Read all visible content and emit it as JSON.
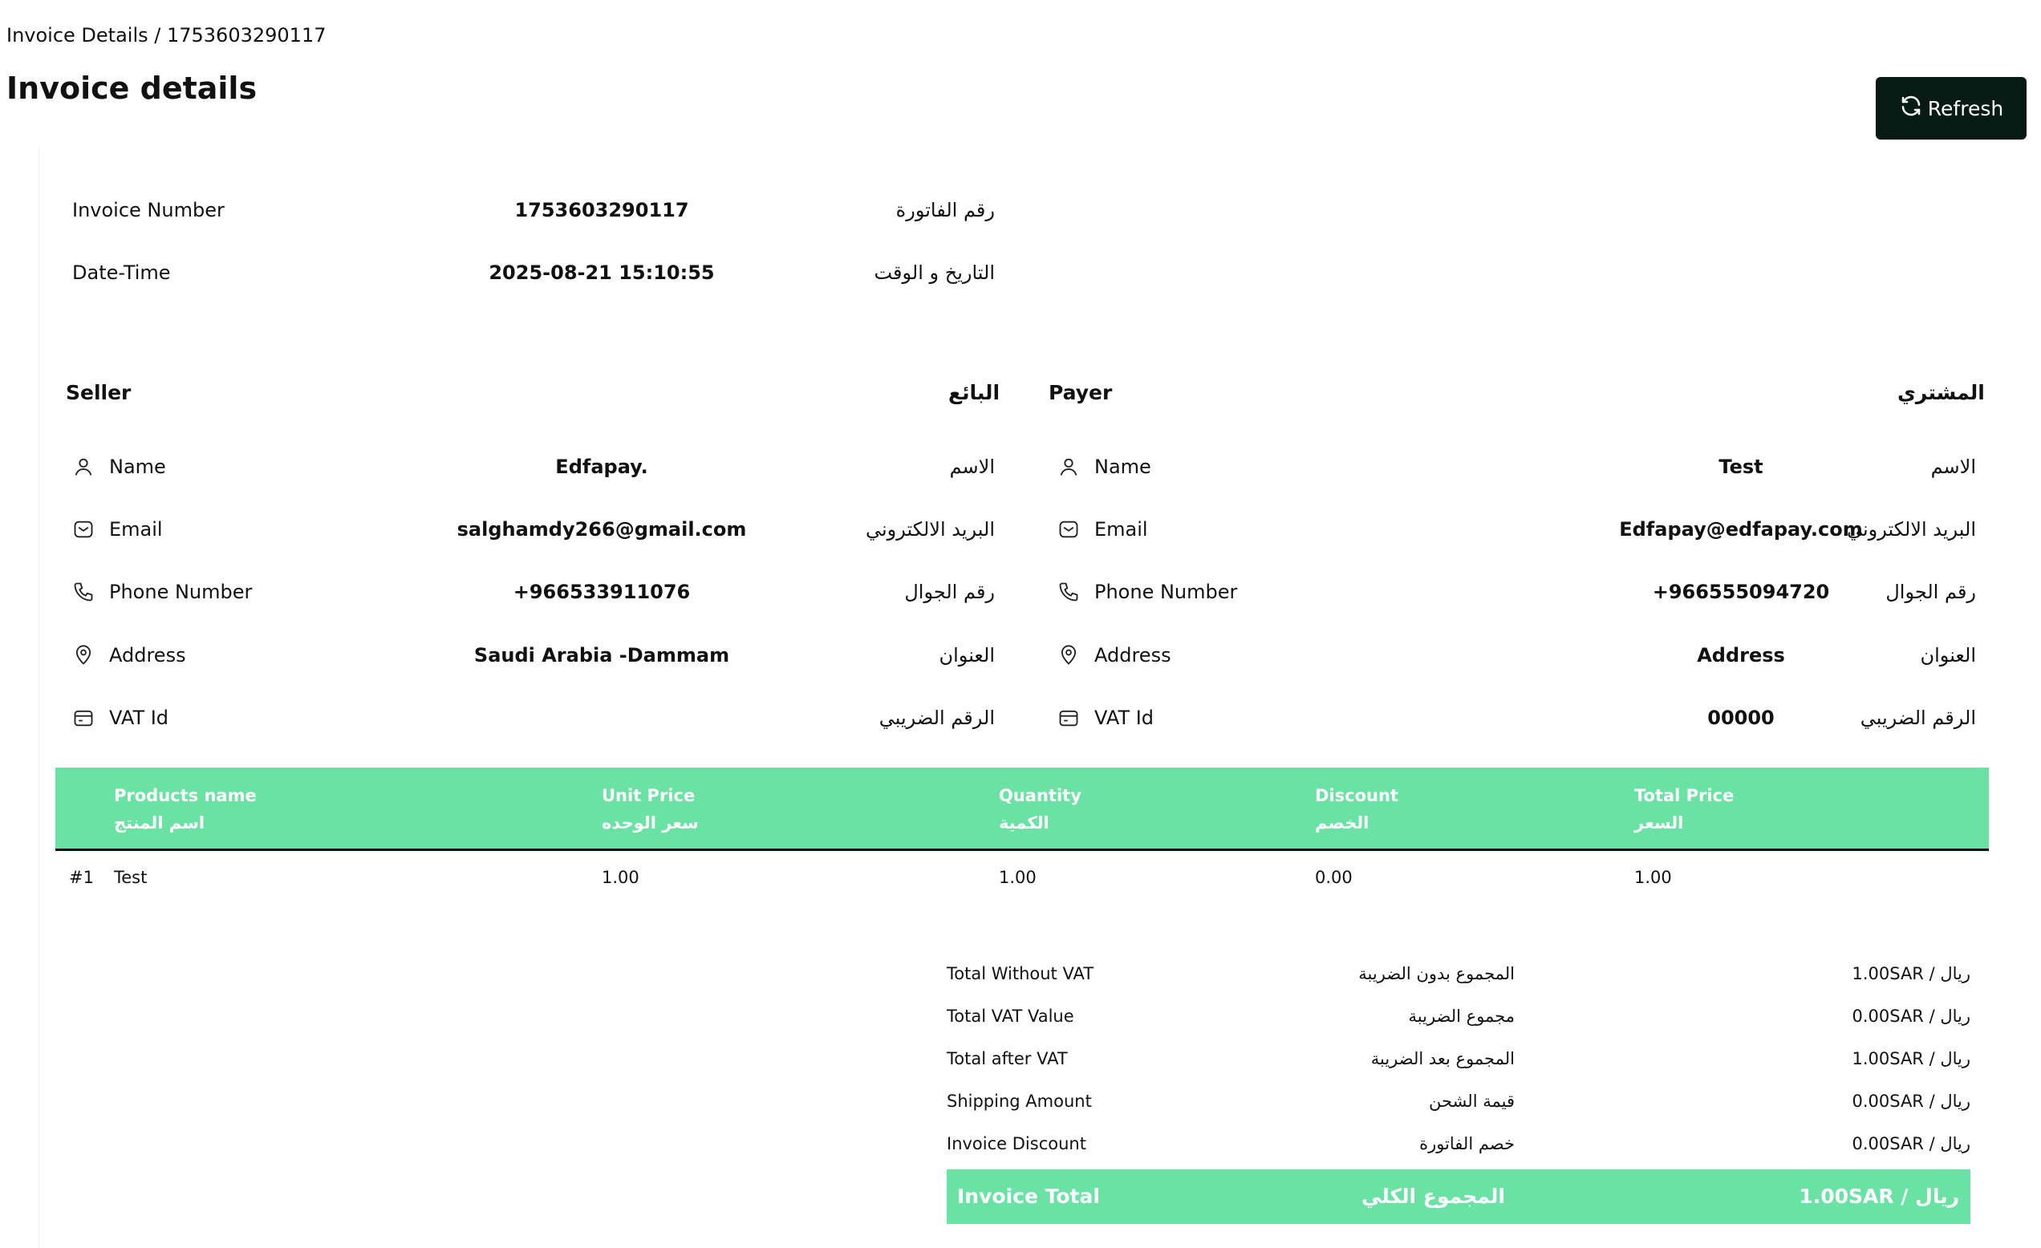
{
  "breadcrumb": "Invoice Details / 1753603290117",
  "title": "Invoice details",
  "refresh_label": "Refresh",
  "invoice": {
    "number_label": "Invoice Number",
    "number_value": "1753603290117",
    "number_ar": "رقم الفاتورة",
    "datetime_label": "Date-Time",
    "datetime_value": "2025-08-21 15:10:55",
    "datetime_ar": "التاريخ و الوقت"
  },
  "seller": {
    "heading": "Seller",
    "heading_ar": "البائع",
    "rows": [
      {
        "icon": "user-icon",
        "label": "Name",
        "value": "Edfapay.",
        "ar": "الاسم"
      },
      {
        "icon": "mail-icon",
        "label": "Email",
        "value": "salghamdy266@gmail.com",
        "ar": "البريد الالكتروني"
      },
      {
        "icon": "phone-icon",
        "label": "Phone Number",
        "value": "+966533911076",
        "ar": "رقم الجوال"
      },
      {
        "icon": "location-icon",
        "label": "Address",
        "value": "Saudi Arabia -Dammam",
        "ar": "العنوان"
      },
      {
        "icon": "card-icon",
        "label": "VAT Id",
        "value": "",
        "ar": "الرقم الضريبي"
      }
    ]
  },
  "payer": {
    "heading": "Payer",
    "heading_ar": "المشتري",
    "rows": [
      {
        "icon": "user-icon",
        "label": "Name",
        "value": "Test",
        "ar": "الاسم"
      },
      {
        "icon": "mail-icon",
        "label": "Email",
        "value": "Edfapay@edfapay.com",
        "ar": "البريد الالكتروني"
      },
      {
        "icon": "phone-icon",
        "label": "Phone Number",
        "value": "+966555094720",
        "ar": "رقم الجوال"
      },
      {
        "icon": "location-icon",
        "label": "Address",
        "value": "Address",
        "ar": "العنوان"
      },
      {
        "icon": "card-icon",
        "label": "VAT Id",
        "value": "00000",
        "ar": "الرقم الضريبي"
      }
    ]
  },
  "table": {
    "headers": [
      {
        "en": "Products name",
        "ar": "اسم المنتج"
      },
      {
        "en": "Unit Price",
        "ar": "سعر الوحده"
      },
      {
        "en": "Quantity",
        "ar": "الكمية"
      },
      {
        "en": "Discount",
        "ar": "الخصم"
      },
      {
        "en": "Total Price",
        "ar": "السعر"
      }
    ],
    "rows": [
      {
        "index": "#1",
        "name": "Test",
        "unit_price": "1.00",
        "quantity": "1.00",
        "discount": "0.00",
        "total": "1.00"
      }
    ]
  },
  "summary": [
    {
      "en": "Total Without VAT",
      "ar": "المجموع بدون الضريبة",
      "amount": "1.00SAR / ريال"
    },
    {
      "en": "Total VAT Value",
      "ar": "مجموع الضريبة",
      "amount": "0.00SAR / ريال"
    },
    {
      "en": "Total after VAT",
      "ar": "المجموع بعد الضريبة",
      "amount": "1.00SAR / ريال"
    },
    {
      "en": "Shipping Amount",
      "ar": "قيمة الشحن",
      "amount": "0.00SAR / ريال"
    },
    {
      "en": "Invoice Discount",
      "ar": "خصم الفاتورة",
      "amount": "0.00SAR / ريال"
    }
  ],
  "total": {
    "en": "Invoice Total",
    "ar": "المجموع الكلي",
    "amount": "1.00SAR / ريال"
  },
  "colors": {
    "accent": "#69e2a4",
    "button": "#071a14"
  }
}
